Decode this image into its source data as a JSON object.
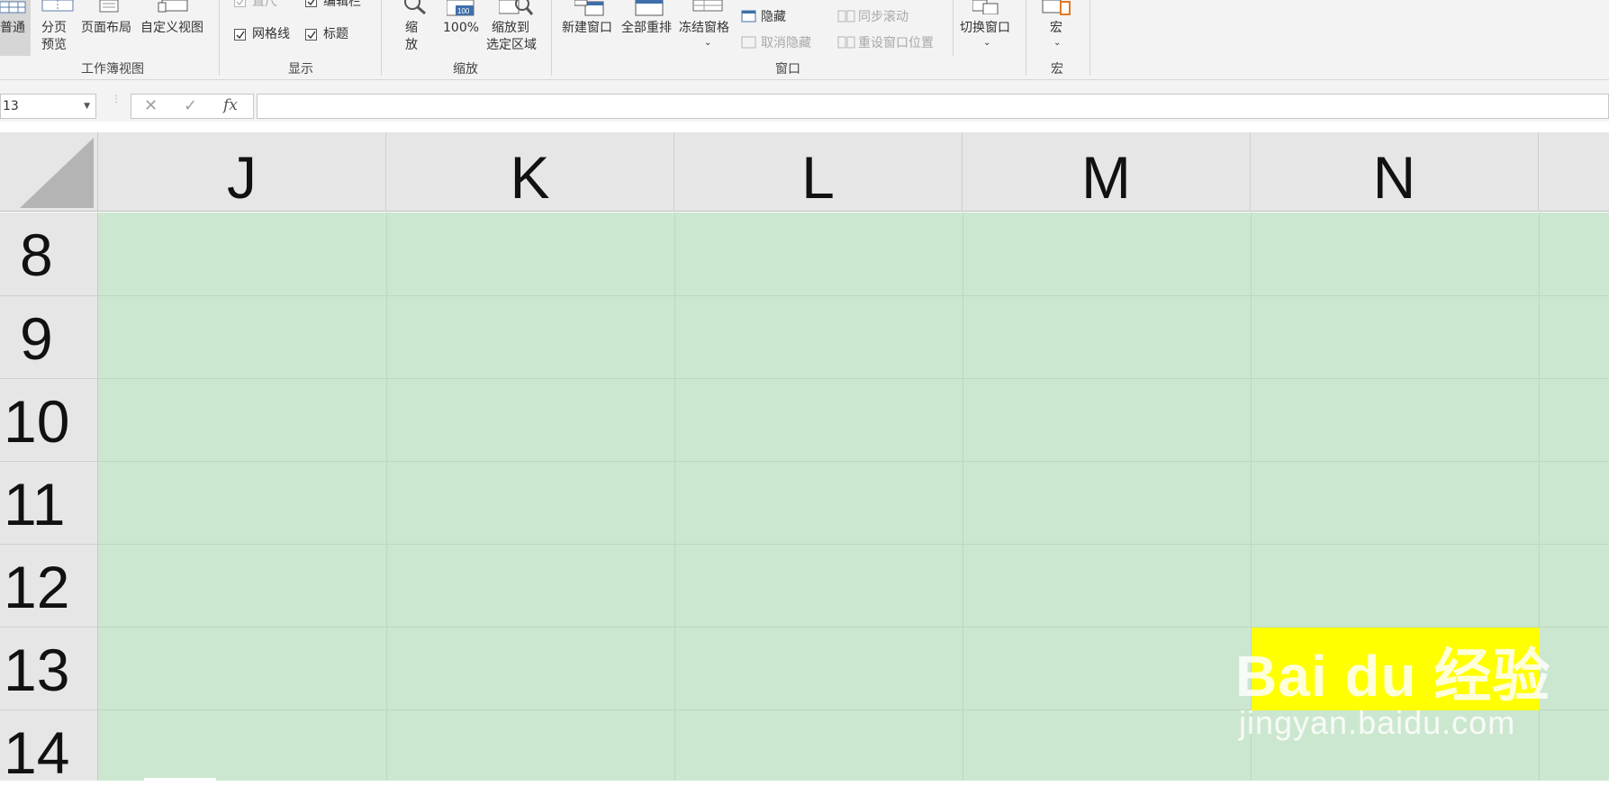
{
  "ribbon": {
    "workbook_views": {
      "normal": "普通",
      "page_break_line1": "分页",
      "page_break_line2": "预览",
      "page_layout": "页面布局",
      "custom_views": "自定义视图",
      "group": "工作簿视图"
    },
    "show": {
      "ruler": "直尺",
      "formula_bar": "编辑栏",
      "gridlines": "网格线",
      "headings": "标题",
      "group": "显示",
      "ruler_checked": true,
      "formula_bar_checked": true,
      "gridlines_checked": true,
      "headings_checked": true
    },
    "zoom": {
      "zoom_line1": "缩",
      "zoom_line2": "放",
      "hundred": "100%",
      "hundred_icon_text": "100",
      "to_selection_line1": "缩放到",
      "to_selection_line2": "选定区域",
      "group": "缩放"
    },
    "window": {
      "new_window": "新建窗口",
      "arrange_all": "全部重排",
      "freeze_panes": "冻结窗格",
      "hide": "隐藏",
      "unhide": "取消隐藏",
      "sync_scroll": "同步滚动",
      "reset_position": "重设窗口位置",
      "switch_windows": "切换窗口",
      "group": "窗口"
    },
    "macros": {
      "macros": "宏",
      "group": "宏"
    }
  },
  "formula_bar": {
    "name_box": "13",
    "cancel_glyph": "✕",
    "enter_glyph": "✓",
    "fx_label": "fx",
    "formula": ""
  },
  "columns": [
    "J",
    "K",
    "L",
    "M",
    "N"
  ],
  "rows": [
    "8",
    "9",
    "10",
    "11",
    "12",
    "13",
    "14"
  ],
  "sheet": {
    "fill_color": "#cce7cf"
  },
  "watermark": {
    "logo_text": "Bai du 经验",
    "url": "jingyan.baidu.com"
  }
}
